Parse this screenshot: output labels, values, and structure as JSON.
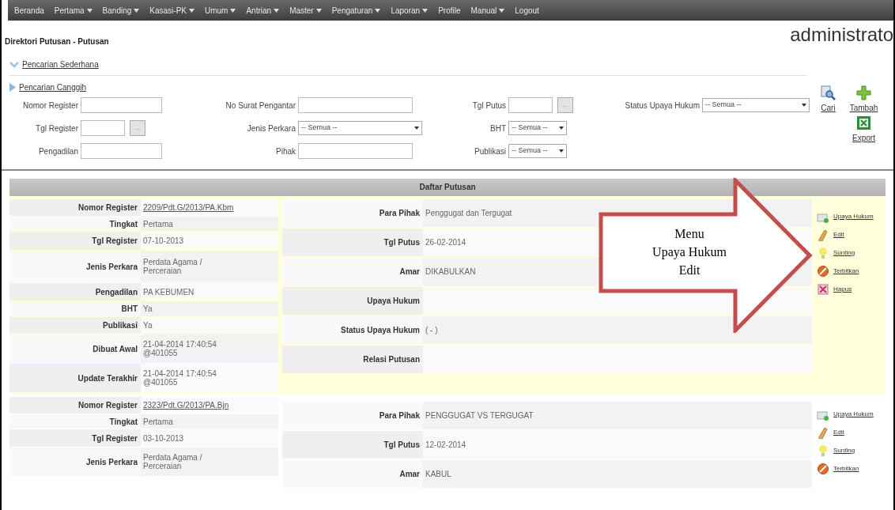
{
  "nav": [
    {
      "label": "Beranda",
      "has_menu": false
    },
    {
      "label": "Pertama",
      "has_menu": true
    },
    {
      "label": "Banding",
      "has_menu": true
    },
    {
      "label": "Kasasi-PK",
      "has_menu": true
    },
    {
      "label": "Umum",
      "has_menu": true
    },
    {
      "label": "Antrian",
      "has_menu": true
    },
    {
      "label": "Master",
      "has_menu": true
    },
    {
      "label": "Pengaturan",
      "has_menu": true
    },
    {
      "label": "Laporan",
      "has_menu": true
    },
    {
      "label": "Profile",
      "has_menu": false
    },
    {
      "label": "Manual",
      "has_menu": true
    },
    {
      "label": "Logout",
      "has_menu": false
    }
  ],
  "page_title": "Direktori Putusan - Putusan",
  "user": "administrato",
  "search_sections": [
    {
      "label": "Pencarian Sederhana",
      "expanded": true
    },
    {
      "label": "Pencarian Canggih",
      "expanded": false
    }
  ],
  "search_rows": [
    [
      {
        "label": "Nomor Register",
        "kind": "text"
      },
      {
        "label": "No Surat Pengantar",
        "kind": "text"
      },
      {
        "label": "Tgl Putus",
        "kind": "date",
        "button": "..."
      },
      {
        "label": "Status Upaya Hukum",
        "kind": "select",
        "value": "-- Semua --"
      }
    ],
    [
      {
        "label": "Tgl Register",
        "kind": "date",
        "button": "..."
      },
      {
        "label": "Jenis Perkara",
        "kind": "select",
        "value": "-- Semua --"
      },
      {
        "label": "BHT",
        "kind": "select-small",
        "value": "-- Semua --"
      }
    ],
    [
      {
        "label": "Pengadilan",
        "kind": "text"
      },
      {
        "label": "Pihak",
        "kind": "text"
      },
      {
        "label": "Publikasi",
        "kind": "select-small",
        "value": "-- Semua --"
      }
    ]
  ],
  "toolbar": [
    {
      "label": "Cari",
      "kind": "search"
    },
    {
      "label": "Tambah",
      "kind": "add"
    },
    {
      "label": "Export",
      "kind": "export"
    }
  ],
  "list_title": "Daftar Putusan",
  "records": [
    {
      "highlighted": true,
      "left": [
        {
          "label": "Nomor Register",
          "value": "2209/Pdt.G/2013/PA.Kbm",
          "link": true
        },
        {
          "label": "Tingkat",
          "value": "Pertama"
        },
        {
          "label": "Tgl Register",
          "value": "07-10-2013"
        },
        {
          "label": "Jenis Perkara",
          "value": "Perdata Agama /\nPerceraian"
        },
        {
          "label": "Pengadilan",
          "value": "PA KEBUMEN"
        },
        {
          "label": "BHT",
          "value": "Ya"
        },
        {
          "label": "Publikasi",
          "value": "Ya"
        },
        {
          "label": "Dibuat Awal",
          "value": "21-04-2014 17:40:54\n@401055"
        },
        {
          "label": "Update Terakhir",
          "value": "21-04-2014 17:40:54\n@401055"
        }
      ],
      "middle": [
        {
          "label": "Para Pihak",
          "value": "Penggugat dan Tergugat"
        },
        {
          "label": "Tgl Putus",
          "value": "26-02-2014"
        },
        {
          "label": "Amar",
          "value": "DIKABULKAN"
        },
        {
          "label": "Upaya Hukum"
        },
        {
          "label": "Status Upaya Hukum",
          "value": "( - )"
        },
        {
          "label": "Relasi Putusan"
        }
      ],
      "actions": [
        {
          "label": "Upaya Hukum",
          "kind": "appeal"
        },
        {
          "label": "Edit",
          "kind": "edit"
        },
        {
          "label": "Sunting",
          "kind": "bulb"
        },
        {
          "label": "Terbitkan",
          "kind": "ban"
        },
        {
          "label": "Hapus",
          "kind": "delete"
        }
      ]
    },
    {
      "highlighted": false,
      "left": [
        {
          "label": "Nomor Register",
          "value": "2323/Pdt.G/2013/PA.Bjn",
          "link": true
        },
        {
          "label": "Tingkat",
          "value": "Pertama"
        },
        {
          "label": "Tgl Register",
          "value": "03-10-2013"
        },
        {
          "label": "Jenis Perkara",
          "value": "Perdata Agama /\nPerceraian"
        }
      ],
      "middle": [
        {
          "label": "Para Pihak",
          "value": "PENGGUGAT VS TERGUGAT"
        },
        {
          "label": "Tgl Putus",
          "value": "12-02-2014"
        },
        {
          "label": "Amar",
          "value": "KABUL"
        }
      ],
      "actions": [
        {
          "label": "Upaya Hukum",
          "kind": "appeal"
        },
        {
          "label": "Edit",
          "kind": "edit"
        },
        {
          "label": "Sunting",
          "kind": "bulb"
        },
        {
          "label": "Terbitkan",
          "kind": "ban"
        }
      ]
    }
  ],
  "callout": {
    "lines": [
      "Menu",
      "Upaya Hukum",
      "Edit"
    ]
  }
}
